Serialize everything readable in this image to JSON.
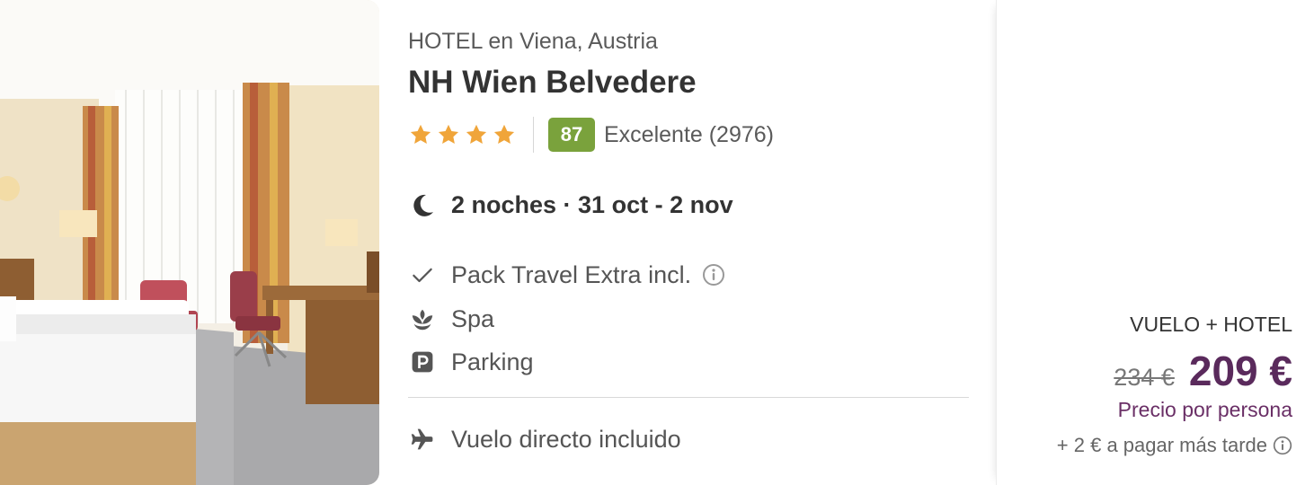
{
  "hotel": {
    "subtitle": "HOTEL en Viena, Austria",
    "name": "NH Wien Belvedere",
    "star_count": 4,
    "star_color": "#f0a53a",
    "score": "87",
    "score_color": "#7aa23c",
    "review_text": "Excelente (2976)"
  },
  "stay": {
    "icon": "moon-icon",
    "text": "2 noches · 31 oct - 2 nov"
  },
  "amenities": [
    {
      "icon": "check-icon",
      "label": "Pack Travel Extra incl.",
      "has_info": true
    },
    {
      "icon": "spa-icon",
      "label": "Spa",
      "has_info": false
    },
    {
      "icon": "parking-icon",
      "label": "Parking",
      "has_info": false
    }
  ],
  "flight": {
    "icon": "plane-icon",
    "label": "Vuelo directo incluido"
  },
  "price": {
    "package_label": "VUELO + HOTEL",
    "old_price": "234 €",
    "new_price": "209 €",
    "per_person": "Precio por persona",
    "later_text": "+ 2 € a pagar más tarde",
    "price_color": "#5a2a5c"
  }
}
